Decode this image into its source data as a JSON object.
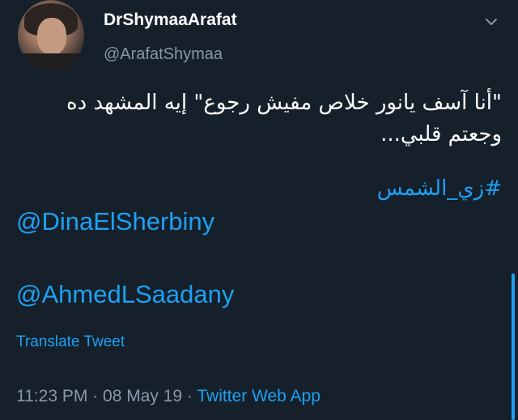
{
  "tweet": {
    "author": {
      "display_name": "DrShymaaArafat",
      "handle": "@ArafatShymaa",
      "avatar_icon": "profile-photo"
    },
    "menu_icon": "chevron-down-icon",
    "text": "\"أنا آسف يانور خلاص مفيش رجوع\" إيه المشهد ده وجعتم قلبي...",
    "hashtag": "#زي_الشمس",
    "mentions": [
      "@DinaElSherbiny",
      "@AhmedLSaadany"
    ],
    "translate_label": "Translate Tweet",
    "time": "11:23 PM",
    "date": "08 May 19",
    "separator": "·",
    "source": "Twitter Web App"
  },
  "colors": {
    "background": "#15202b",
    "primary_text": "#ffffff",
    "secondary_text": "#8899a6",
    "accent": "#1da1f2"
  }
}
